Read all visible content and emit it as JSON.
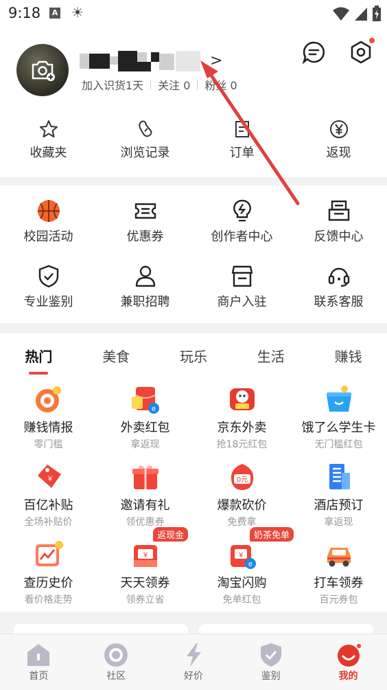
{
  "status_bar": {
    "time": "9:18",
    "a_icon": "A"
  },
  "profile": {
    "join_text": "加入识货1天",
    "follow_text": "关注 0",
    "fans_text": "粉丝 0",
    "chevron": ">"
  },
  "quick_links": [
    {
      "label": "收藏夹",
      "icon": "star-icon"
    },
    {
      "label": "浏览记录",
      "icon": "footprint-icon"
    },
    {
      "label": "订单",
      "icon": "order-icon"
    },
    {
      "label": "返现",
      "icon": "yen-icon"
    }
  ],
  "services": [
    {
      "label": "校园活动",
      "icon": "basketball-icon"
    },
    {
      "label": "优惠券",
      "icon": "coupon-icon"
    },
    {
      "label": "创作者中心",
      "icon": "lightbulb-icon"
    },
    {
      "label": "反馈中心",
      "icon": "feedback-icon"
    },
    {
      "label": "专业鉴别",
      "icon": "shield-check-icon"
    },
    {
      "label": "兼职招聘",
      "icon": "person-icon"
    },
    {
      "label": "商户入驻",
      "icon": "store-icon"
    },
    {
      "label": "联系客服",
      "icon": "headset-icon"
    }
  ],
  "tabs": [
    "热门",
    "美食",
    "玩乐",
    "生活",
    "赚钱"
  ],
  "deals": [
    {
      "title": "赚钱情报",
      "subtitle": "零门槛",
      "badge": ""
    },
    {
      "title": "外卖红包",
      "subtitle": "拿返现",
      "badge": ""
    },
    {
      "title": "京东外卖",
      "subtitle": "抢18元红包",
      "badge": ""
    },
    {
      "title": "饿了么学生卡",
      "subtitle": "无门槛红包",
      "badge": ""
    },
    {
      "title": "百亿补贴",
      "subtitle": "全场补贴价",
      "badge": ""
    },
    {
      "title": "邀请有礼",
      "subtitle": "领优惠券",
      "badge": ""
    },
    {
      "title": "爆款砍价",
      "subtitle": "免费拿",
      "badge": ""
    },
    {
      "title": "酒店预订",
      "subtitle": "拿返现",
      "badge": ""
    },
    {
      "title": "查历史价",
      "subtitle": "看价格走势",
      "badge": ""
    },
    {
      "title": "天天领券",
      "subtitle": "领券立省",
      "badge": "返现金"
    },
    {
      "title": "淘宝闪购",
      "subtitle": "免单红包",
      "badge": "奶茶免单"
    },
    {
      "title": "打车领券",
      "subtitle": "百元券包",
      "badge": ""
    }
  ],
  "bottom_nav": [
    {
      "label": "首页",
      "icon": "home-icon"
    },
    {
      "label": "社区",
      "icon": "community-icon"
    },
    {
      "label": "好价",
      "icon": "lightning-icon"
    },
    {
      "label": "鉴别",
      "icon": "shield-icon"
    },
    {
      "label": "我的",
      "icon": "smile-icon"
    }
  ],
  "colors": {
    "accent": "#e3382a",
    "background": "#f2f2f2"
  }
}
